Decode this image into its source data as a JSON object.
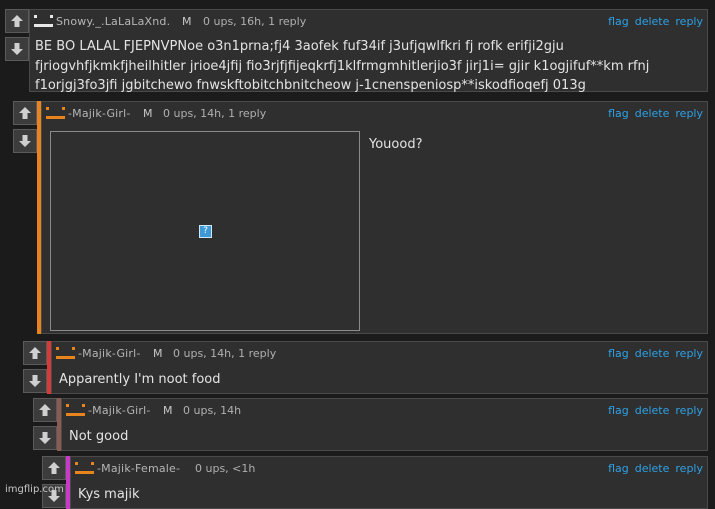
{
  "colors": {
    "background": "#1b1b1b",
    "panel": "#2f2f2f",
    "link": "#2ea1e6",
    "avatar_white": "#e8e8e8",
    "avatar_orange": "#e8841c",
    "stripe_orange": "#e8841c",
    "stripe_red": "#d83a3a",
    "stripe_brown": "#8b5a52",
    "stripe_magenta": "#c83ac8"
  },
  "icons": {
    "upvote": "arrow-up-icon",
    "downvote": "arrow-down-icon",
    "broken_image": "broken-image-icon",
    "avatar": "avatar-icon"
  },
  "actions": {
    "flag": "flag",
    "delete": "delete",
    "reply": "reply"
  },
  "comments": [
    {
      "username": "Snowy._.LaLaLaXnd.",
      "mod": "M",
      "meta": "0 ups, 16h, 1 reply",
      "text": "BE BO LALAL FJEPNVPNoe o3n1prna;fj4 3aofek fuf34if j3ufjqwlfkri fj rofk erifji2gju fjriogvhfjkmkfjheilhitler jrioe4jfij fio3rjfjfijeqkrfj1klfrmgmhitlerjio3f jirj1i= gjir k1ogjifuf**km rfnj f1orjgj3fo3jfi jgbitchewo fnwskftobitchbnitcheow j-1cnenspeniosp**iskodfioqefj 013g"
    },
    {
      "username": "-Majik-Girl-",
      "mod": "M",
      "meta": "0 ups, 14h, 1 reply",
      "text": "Youood?",
      "image_placeholder": "?"
    },
    {
      "username": "-Majik-Girl-",
      "mod": "M",
      "meta": "0 ups, 14h, 1 reply",
      "text": "Apparently I'm noot food"
    },
    {
      "username": "-Majik-Girl-",
      "mod": "M",
      "meta": "0 ups, 14h",
      "text": "Not good"
    },
    {
      "username": "-Majik-Female-",
      "mod": "",
      "meta": "0 ups, <1h",
      "text": "Kys majik"
    }
  ],
  "watermark": "imgflip.com"
}
